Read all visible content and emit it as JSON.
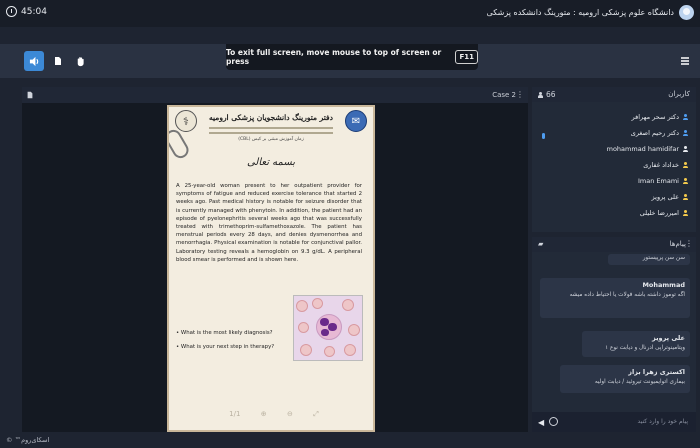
{
  "header": {
    "timer": "45:04",
    "app_title": "دانشگاه علوم پزشکی ارومیه : متورینگ دانشکده پزشکی",
    "fullscreen_notice": "To exit full screen, move mouse to top of screen or press",
    "fullscreen_key": "F11"
  },
  "main": {
    "case_label": "Case 2",
    "document": {
      "title": "دفتر متورینگ دانشجویان پزشکی ارومیه",
      "subtitle": "زمان آموزش مبتنی بر کیس (CBL)",
      "bismillah": "بسمه تعالی",
      "case_text": "A 25-year-old woman present to her outpatient provider for symptoms of fatigue and reduced exercise tolerance that started 2 weeks ago. Past medical history is notable for seizure disorder that is currently managed with phenytoin. In addition, the patient had an episode of pyelonephritis several weeks ago that was successfully treated with trimethoprim-sulfamethoxazole. The patient has menstrual periods every 28 days, and denies dysmenorrhea and menorrhagia. Physical examination is notable for conjunctival pallor. Laboratory testing reveals a hemoglobin on 9.3 g/dL. A peripheral blood smear is performed and is shown here.",
      "questions": [
        "• What is the most likely diagnosis?",
        "• What is your next step in therapy?"
      ],
      "page_indicator": "1/1"
    }
  },
  "users": {
    "count": "66",
    "title": "کاربران",
    "list": [
      {
        "name": "دکتر سحر مهرافر",
        "color": "#4f9df0"
      },
      {
        "name": "دکتر رحیم اصغری",
        "color": "#4f9df0"
      },
      {
        "name": "mohammad hamidifar",
        "color": "#e6e9ee"
      },
      {
        "name": "خداداد غفاری",
        "color": "#f2c94c"
      },
      {
        "name": "Iman Emami",
        "color": "#f2c94c"
      },
      {
        "name": "علی پرویز",
        "color": "#f2c94c"
      },
      {
        "name": "امیررضا خلیلی",
        "color": "#f2c94c"
      }
    ]
  },
  "chat": {
    "title": "پیام‌ها",
    "partial_top": "سن سن پرپیستور",
    "messages": [
      {
        "sender": "Mohammad",
        "body": "اگه توموز داشته باشه فولات یا احتیاط داده میشه"
      },
      {
        "sender": "علی پرویز",
        "body": "ویتامینو‌تراپی ادرنال و دیابت نوع ۱"
      },
      {
        "sender": "اکستری زهرا بزاز",
        "body": "بیماری اتوایمیونت تیروئید / دیابت اولیه"
      }
    ],
    "input_placeholder": "پیام خود را وارد کنید"
  },
  "footer": "اسکای‌روم™ ©"
}
